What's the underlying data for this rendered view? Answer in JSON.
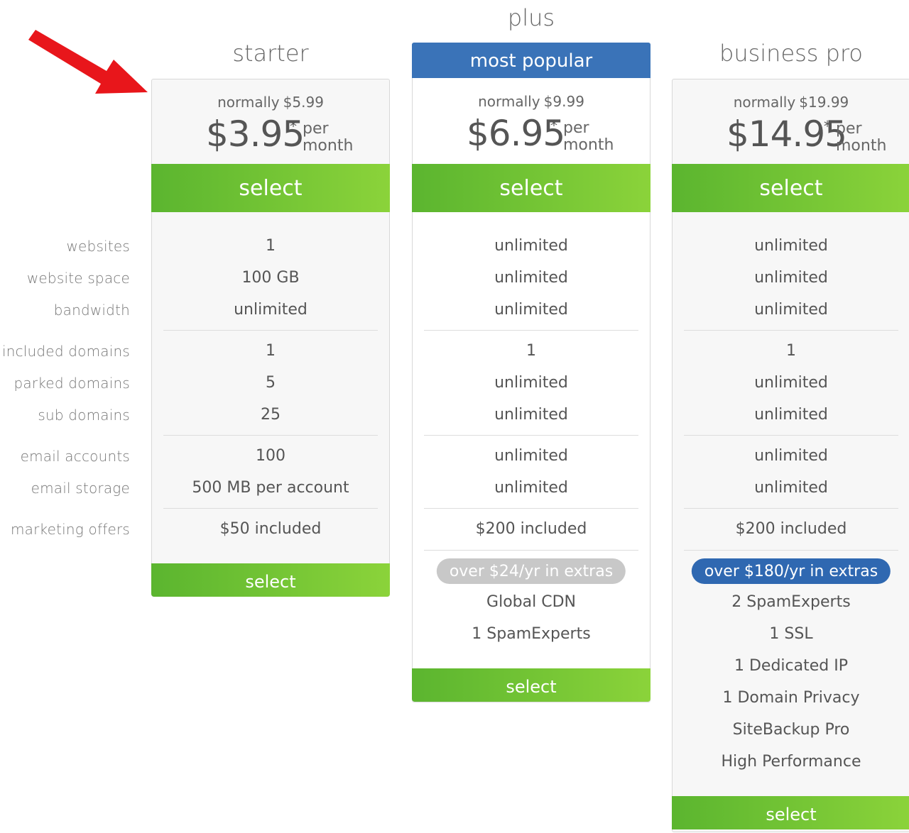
{
  "row_labels": {
    "websites": "websites",
    "website_space": "website space",
    "bandwidth": "bandwidth",
    "included_domains": "included domains",
    "parked_domains": "parked domains",
    "sub_domains": "sub domains",
    "email_accounts": "email accounts",
    "email_storage": "email storage",
    "marketing_offers": "marketing offers"
  },
  "plans": {
    "starter": {
      "title": "starter",
      "normally_label": "normally",
      "old_price": "$5.99",
      "price": "$3.95",
      "asterisk": "*",
      "per": "per",
      "month": "month",
      "select_top": "select",
      "websites": "1",
      "website_space": "100 GB",
      "bandwidth": "unlimited",
      "included_domains": "1",
      "parked_domains": "5",
      "sub_domains": "25",
      "email_accounts": "100",
      "email_storage": "500 MB per account",
      "marketing_offers": "$50 included",
      "select_bottom": "select"
    },
    "plus": {
      "title": "plus",
      "banner": "most popular",
      "normally_label": "normally",
      "old_price": "$9.99",
      "price": "$6.95",
      "asterisk": "*",
      "per": "per",
      "month": "month",
      "select_top": "select",
      "websites": "unlimited",
      "website_space": "unlimited",
      "bandwidth": "unlimited",
      "included_domains": "1",
      "parked_domains": "unlimited",
      "sub_domains": "unlimited",
      "email_accounts": "unlimited",
      "email_storage": "unlimited",
      "marketing_offers": "$200 included",
      "extras_badge": "over $24/yr in extras",
      "extras": [
        "Global CDN",
        "1 SpamExperts"
      ],
      "select_bottom": "select"
    },
    "business_pro": {
      "title": "business pro",
      "normally_label": "normally",
      "old_price": "$19.99",
      "price": "$14.95",
      "asterisk": "*",
      "per": "per",
      "month": "month",
      "select_top": "select",
      "websites": "unlimited",
      "website_space": "unlimited",
      "bandwidth": "unlimited",
      "included_domains": "1",
      "parked_domains": "unlimited",
      "sub_domains": "unlimited",
      "email_accounts": "unlimited",
      "email_storage": "unlimited",
      "marketing_offers": "$200 included",
      "extras_badge": "over $180/yr in extras",
      "extras": [
        "2 SpamExperts",
        "1 SSL",
        "1 Dedicated IP",
        "1 Domain Privacy",
        "SiteBackup Pro",
        "High Performance"
      ],
      "select_bottom": "select"
    }
  },
  "colors": {
    "banner_blue": "#3a73b8",
    "select_green_start": "#5bb52f",
    "select_green_end": "#8bd33a",
    "arrow_red": "#e8161b",
    "badge_grey": "#c8c8c8",
    "badge_blue": "#2f68b1"
  },
  "icons": {
    "annotation": "red-arrow-icon"
  }
}
